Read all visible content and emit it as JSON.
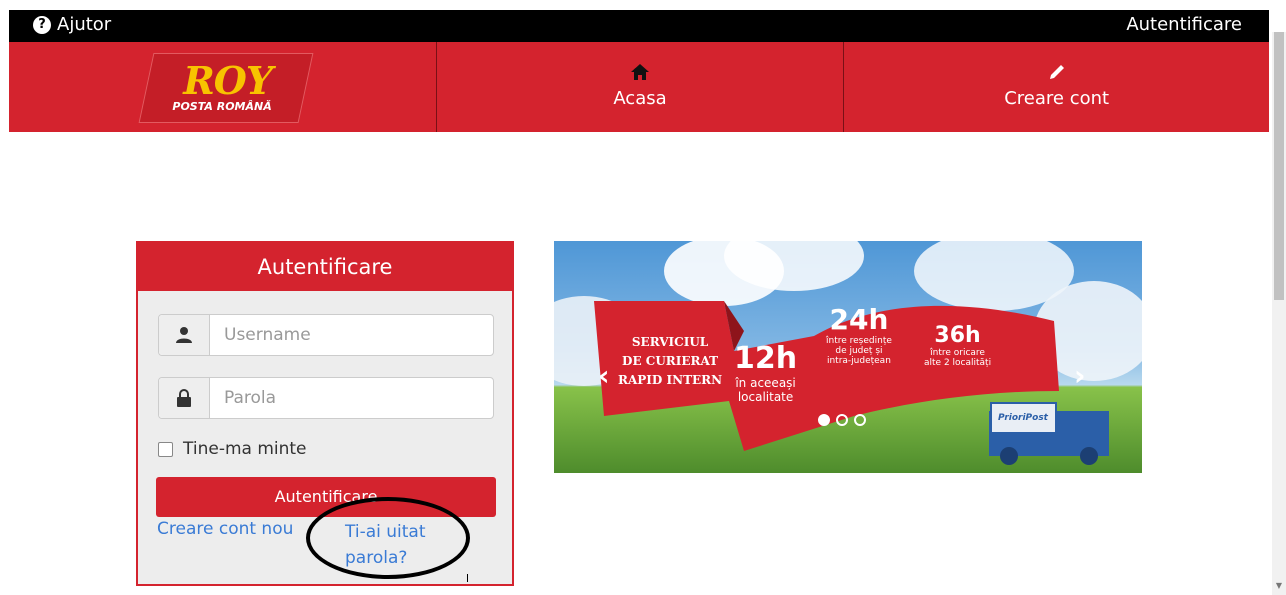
{
  "topbar": {
    "help_label": "Ajutor",
    "help_icon": "question-circle-icon",
    "login_label": "Autentificare"
  },
  "logo": {
    "brand": "ROY",
    "subtitle": "POSTA ROMÂNĂ"
  },
  "nav": [
    {
      "label": "Acasa",
      "icon": "home-icon"
    },
    {
      "label": "Creare cont",
      "icon": "pencil-icon"
    }
  ],
  "login": {
    "title": "Autentificare",
    "username_placeholder": "Username",
    "password_placeholder": "Parola",
    "remember_label": "Tine-ma minte",
    "submit_label": "Autentificare",
    "create_account_link": "Creare cont nou",
    "forgot_password_link": "Ti-ai uitat parola?"
  },
  "banner": {
    "service_line1": "SERVICIUL",
    "service_line2": "DE CURIERAT",
    "service_line3": "RAPID INTERN",
    "h12": "12h",
    "h12_desc1": "în aceeași",
    "h12_desc2": "localitate",
    "h24": "24h",
    "h24_desc1": "între reședințe",
    "h24_desc2": "de județ și",
    "h24_desc3": "intra-județean",
    "h36": "36h",
    "h36_desc1": "între oricare",
    "h36_desc2": "alte 2 localități",
    "truck_label": "PrioriPost",
    "active_slide": 1,
    "slide_count": 3
  },
  "colors": {
    "brand_red": "#d4232e",
    "link_blue": "#3a7bd5",
    "logo_yellow": "#f8c300"
  }
}
